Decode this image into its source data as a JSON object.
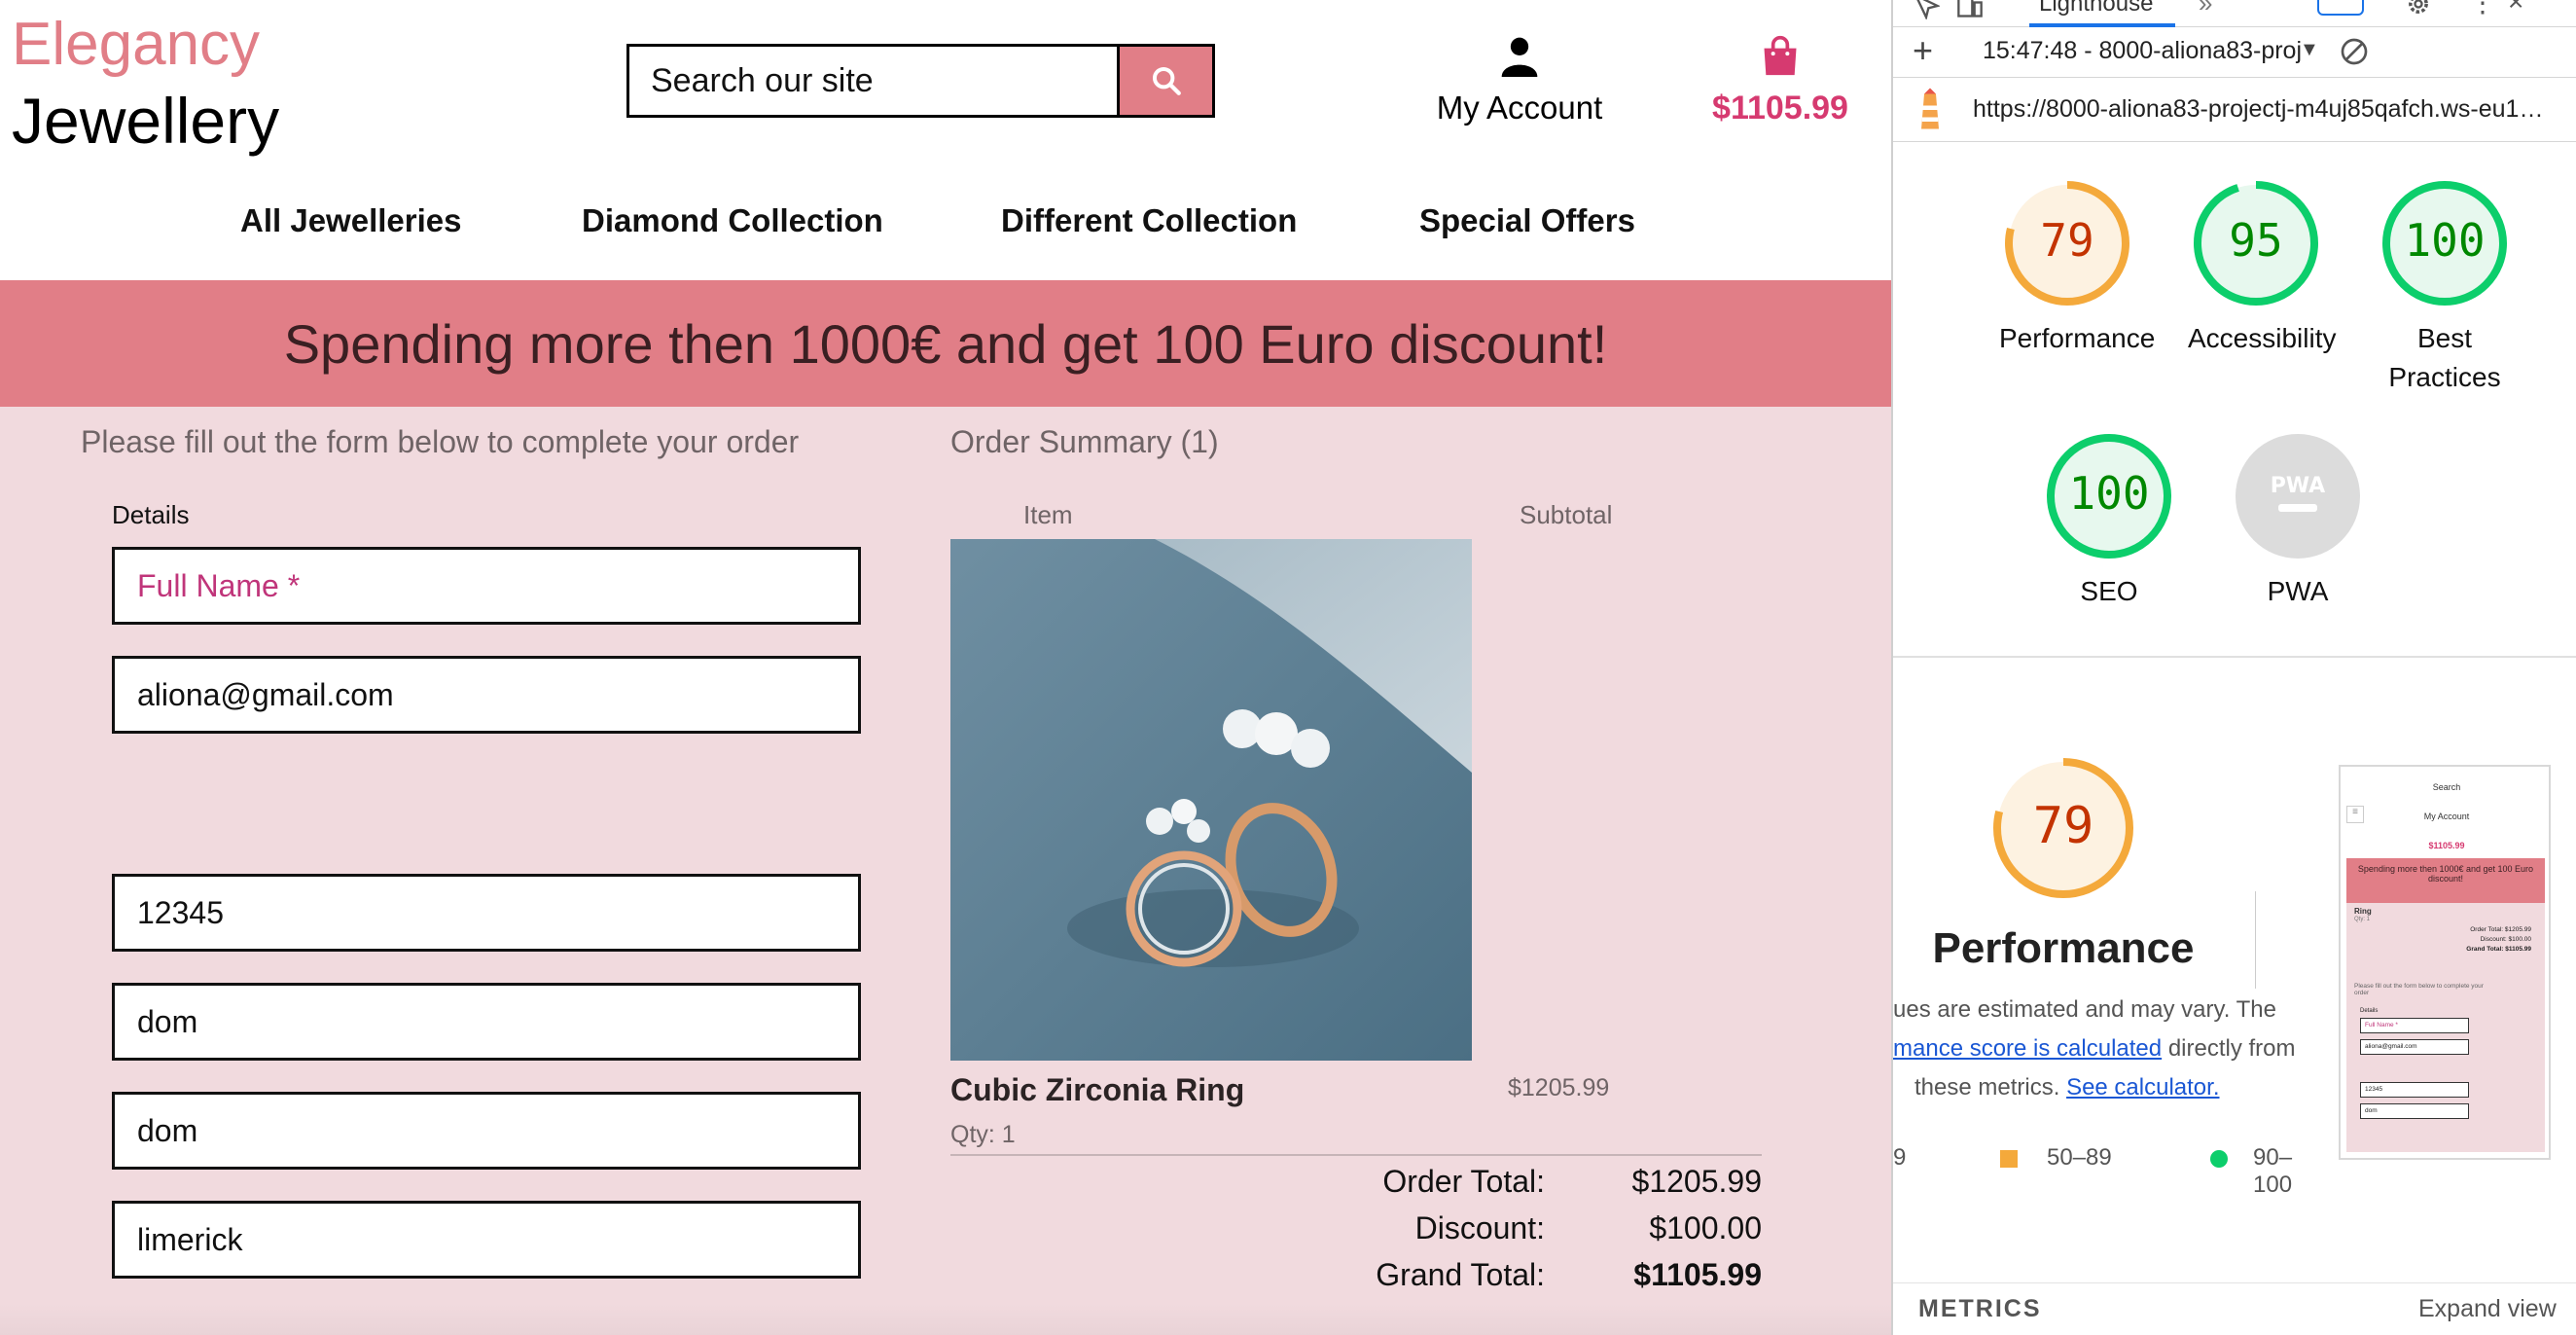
{
  "site": {
    "logo": {
      "line1": "Elegancy",
      "line2": "Jewellery"
    },
    "search": {
      "placeholder": "Search our site"
    },
    "account": {
      "label": "My Account"
    },
    "cart": {
      "total": "$1105.99"
    },
    "nav": [
      "All Jewelleries",
      "Diamond Collection",
      "Different Collection",
      "Special Offers"
    ],
    "banner": "Spending more then 1000€ and get 100 Euro discount!",
    "form": {
      "intro": "Please fill out the form below to complete your order",
      "details_label": "Details",
      "full_name_placeholder": "Full Name *",
      "email": "aliona@gmail.com",
      "postcode": "12345",
      "address1": "dom",
      "address2": "dom",
      "city": "limerick"
    },
    "summary": {
      "title": "Order Summary (1)",
      "col_item": "Item",
      "col_subtotal": "Subtotal",
      "product_name": "Cubic Zirconia Ring",
      "qty": "Qty: 1",
      "subtotal": "$1205.99",
      "order_total_label": "Order Total:",
      "order_total": "$1205.99",
      "discount_label": "Discount:",
      "discount": "$100.00",
      "grand_total_label": "Grand Total:",
      "grand_total": "$1105.99"
    },
    "colors": {
      "accent": "#e17e87",
      "page_bg": "#f1dade",
      "price": "#d63a70"
    }
  },
  "devtools": {
    "tab": "Lighthouse",
    "report_select": "15:47:48 - 8000-aliona83-proj",
    "url": "https://8000-aliona83-projectj-m4uj85qafch.ws-eu1…",
    "scores": [
      {
        "name": "Performance",
        "value": "79",
        "fraction": 0.79,
        "color": "#f4a93b",
        "text_color": "#c33300"
      },
      {
        "name": "Accessibility",
        "value": "95",
        "fraction": 0.95,
        "color": "#0cce6b",
        "text_color": "#008800"
      },
      {
        "name": "Best Practices",
        "value": "100",
        "fraction": 1.0,
        "color": "#0cce6b",
        "text_color": "#008800"
      },
      {
        "name": "SEO",
        "value": "100",
        "fraction": 1.0,
        "color": "#0cce6b",
        "text_color": "#008800"
      },
      {
        "name": "PWA",
        "value": "PWA",
        "fraction": 0,
        "color": "#cccccc",
        "text_color": "#ffffff"
      }
    ],
    "performance_big": {
      "value": "79",
      "label": "Performance"
    },
    "note": {
      "line1": "ues are estimated and may vary. The",
      "link1": "mance score is calculated",
      "line2_rest": "directly from",
      "line3": "these metrics.",
      "link2": "See calculator."
    },
    "legend": {
      "fail": "9",
      "average": "50–89",
      "pass": "90–100"
    },
    "thumbnail": {
      "search": "Search",
      "account": "My Account",
      "total": "$1105.99",
      "banner": "Spending more then 1000€ and get 100 Euro discount!",
      "item": "Ring",
      "qty": "Qty: 1",
      "order_total": "Order Total:   $1205.99",
      "discount": "Discount:   $100.00",
      "grand_total": "Grand Total:   $1105.99",
      "intro": "Please fill out the form below to complete your order",
      "details": "Details",
      "full_name": "Full Name *",
      "email": "aliona@gmail.com",
      "postcode": "12345",
      "address": "dom"
    },
    "metrics_label": "METRICS",
    "expand_view": "Expand view"
  }
}
